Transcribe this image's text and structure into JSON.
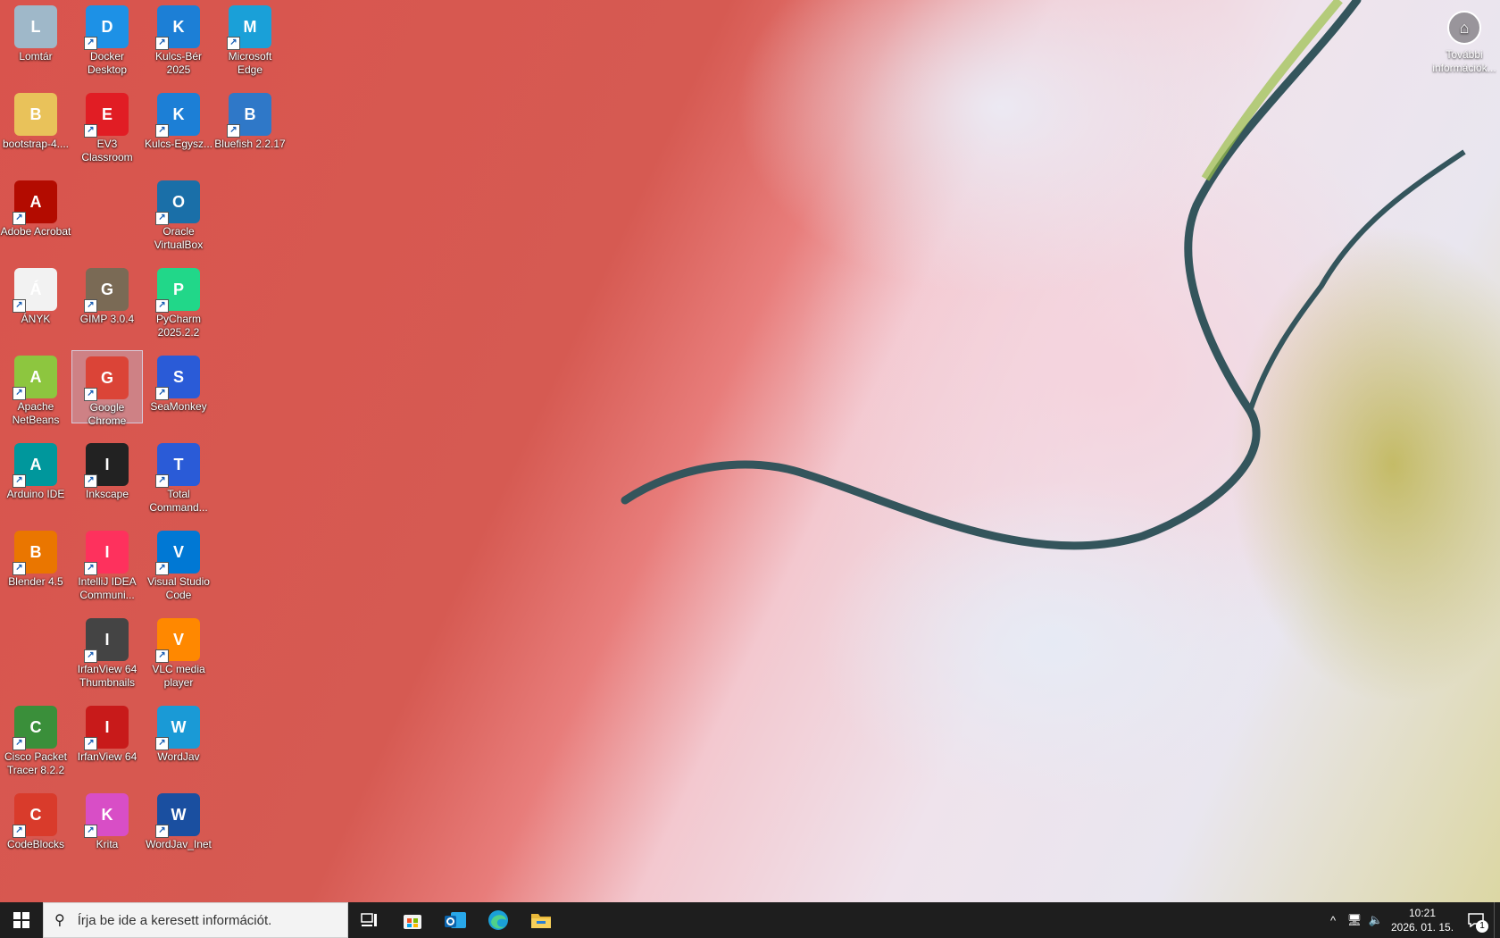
{
  "desktop": {
    "icons": [
      {
        "label": "Lomtár",
        "icon": "recycle-bin-icon",
        "color": "#9fb8c9"
      },
      {
        "label": "Docker Desktop",
        "icon": "docker-icon",
        "color": "#1d91e6"
      },
      {
        "label": "Kulcs-Bér 2025",
        "icon": "kulcs-ber-icon",
        "color": "#1c7fd6"
      },
      {
        "label": "Microsoft Edge",
        "icon": "edge-icon",
        "color": "#1aa0d8"
      },
      {
        "label": "bootstrap-4....",
        "icon": "folder-icon",
        "color": "#e9c25a"
      },
      {
        "label": "EV3 Classroom",
        "icon": "ev3-icon",
        "color": "#e11d24"
      },
      {
        "label": "Kulcs-Egysz...",
        "icon": "kulcs-egysz-icon",
        "color": "#1c7fd6"
      },
      {
        "label": "Bluefish 2.2.17",
        "icon": "bluefish-icon",
        "color": "#2f78c8"
      },
      {
        "label": "Adobe Acrobat",
        "icon": "acrobat-icon",
        "color": "#b30b00"
      },
      {
        "label": "Oracle VirtualBox",
        "icon": "virtualbox-icon",
        "color": "#1a6fa8"
      },
      {
        "label": "ÁNYK",
        "icon": "document-icon",
        "color": "#f2f2f2"
      },
      {
        "label": "GIMP 3.0.4",
        "icon": "gimp-icon",
        "color": "#7a6a55"
      },
      {
        "label": "PyCharm 2025.2.2",
        "icon": "pycharm-icon",
        "color": "#21d789"
      },
      {
        "label": "Apache NetBeans",
        "icon": "netbeans-icon",
        "color": "#8dc63f"
      },
      {
        "label": "Google Chrome",
        "icon": "chrome-icon",
        "color": "#db4437"
      },
      {
        "label": "SeaMonkey",
        "icon": "seamonkey-icon",
        "color": "#2a5bd7"
      },
      {
        "label": "Arduino IDE",
        "icon": "arduino-icon",
        "color": "#00979c"
      },
      {
        "label": "Inkscape",
        "icon": "inkscape-icon",
        "color": "#222222"
      },
      {
        "label": "Total Command...",
        "icon": "total-commander-icon",
        "color": "#2a5bd7"
      },
      {
        "label": "Blender 4.5",
        "icon": "blender-icon",
        "color": "#ea7600"
      },
      {
        "label": "IntelliJ IDEA Communi...",
        "icon": "intellij-icon",
        "color": "#fe315d"
      },
      {
        "label": "Visual Studio Code",
        "icon": "vscode-icon",
        "color": "#0078d4"
      },
      {
        "label": "IrfanView 64 Thumbnails",
        "icon": "panda-icon",
        "color": "#444444"
      },
      {
        "label": "VLC media player",
        "icon": "vlc-icon",
        "color": "#ff8800"
      },
      {
        "label": "Cisco Packet Tracer 8.2.2",
        "icon": "packet-tracer-icon",
        "color": "#3a8f3a"
      },
      {
        "label": "IrfanView 64",
        "icon": "irfanview-icon",
        "color": "#c81a1a"
      },
      {
        "label": "WordJav",
        "icon": "wordjav-icon",
        "color": "#1a9ad6"
      },
      {
        "label": "CodeBlocks",
        "icon": "codeblocks-icon",
        "color": "#d93b2b"
      },
      {
        "label": "Krita",
        "icon": "krita-icon",
        "color": "#d84ec6"
      },
      {
        "label": "WordJav_Inet",
        "icon": "wordjav-inet-icon",
        "color": "#1a4fa0"
      }
    ],
    "spotlight": {
      "label": "További információk...",
      "icon": "spotlight-info-icon"
    }
  },
  "taskbar": {
    "start_icon": "windows-start-icon",
    "search_placeholder": "Írja be ide a keresett információt.",
    "pinned": [
      {
        "name": "task-view",
        "icon": "task-view-icon"
      },
      {
        "name": "microsoft-store",
        "icon": "store-icon"
      },
      {
        "name": "outlook",
        "icon": "outlook-icon"
      },
      {
        "name": "edge",
        "icon": "edge-icon"
      },
      {
        "name": "file-explorer",
        "icon": "folder-icon"
      }
    ],
    "clock": {
      "time": "10:21",
      "date": "2026. 01. 15."
    },
    "notification_count": "1"
  }
}
